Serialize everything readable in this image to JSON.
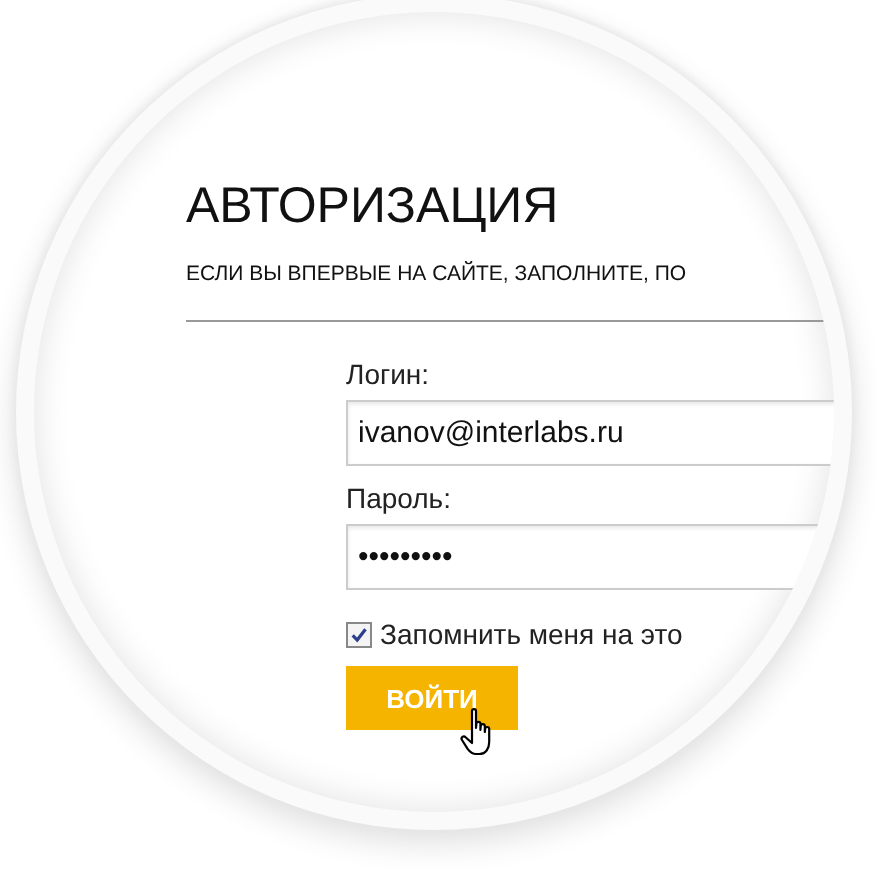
{
  "title": "АВТОРИЗАЦИЯ",
  "subtitle": "ЕСЛИ ВЫ ВПЕРВЫЕ НА САЙТЕ, ЗАПОЛНИТЕ, ПО",
  "fields": [
    {
      "label": "Логин:",
      "value": "ivanov@interlabs.ru"
    },
    {
      "label": "Пароль:",
      "value": "•••••••••"
    }
  ],
  "remember": {
    "label": "Запомнить меня на это",
    "checked": true
  },
  "button": "ВОЙТИ"
}
